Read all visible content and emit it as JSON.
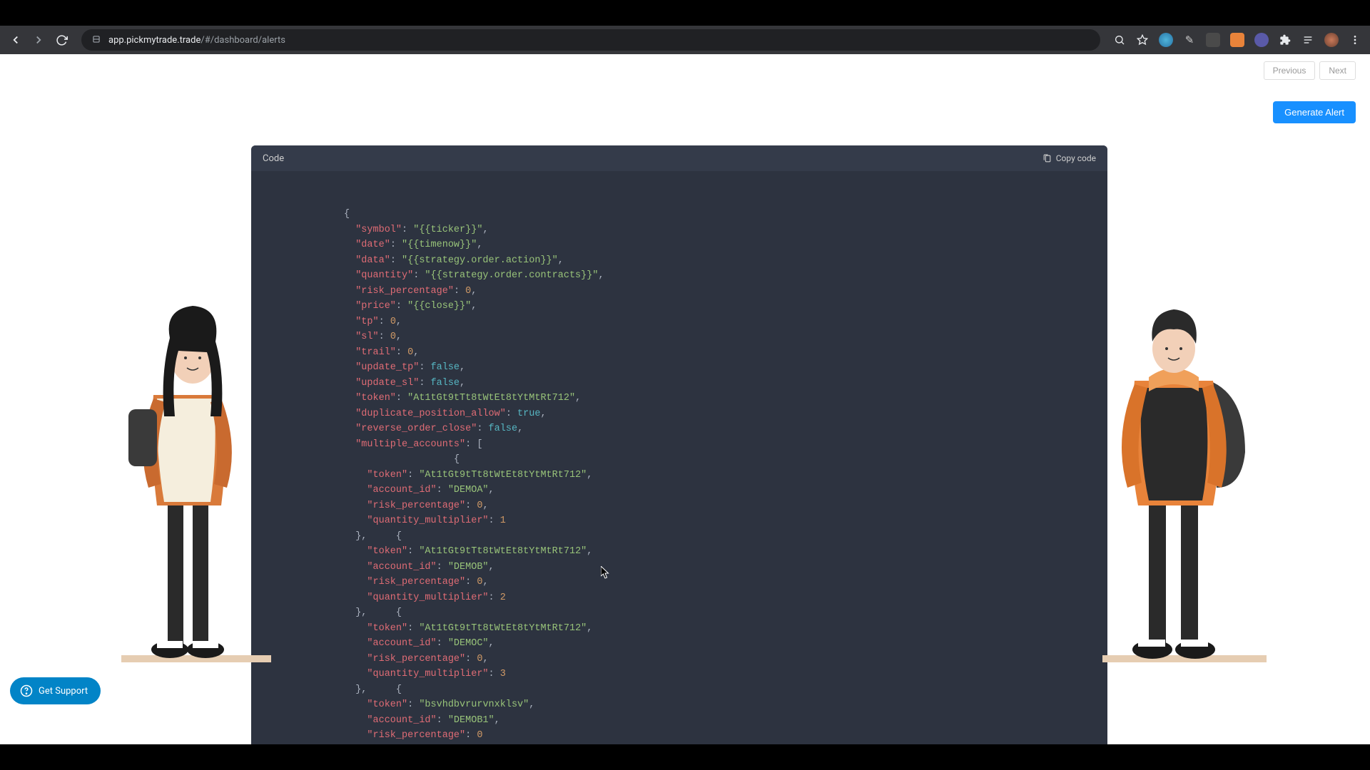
{
  "browser": {
    "url_host": "app.pickmytrade.trade",
    "url_path": "/#/dashboard/alerts"
  },
  "pagination": {
    "prev": "Previous",
    "next": "Next"
  },
  "actions": {
    "generate_alert": "Generate Alert"
  },
  "code_panel": {
    "title": "Code",
    "copy_label": "Copy code"
  },
  "support": {
    "label": "Get Support"
  },
  "code_json": {
    "symbol": "{{ticker}}",
    "date": "{{timenow}}",
    "data": "{{strategy.order.action}}",
    "quantity": "{{strategy.order.contracts}}",
    "risk_percentage": 0,
    "price": "{{close}}",
    "tp": 0,
    "sl": 0,
    "trail": 0,
    "update_tp": false,
    "update_sl": false,
    "token": "At1tGt9tTt8tWtEt8tYtMtRt712",
    "duplicate_position_allow": true,
    "reverse_order_close": false,
    "multiple_accounts": [
      {
        "token": "At1tGt9tTt8tWtEt8tYtMtRt712",
        "account_id": "DEMOA",
        "risk_percentage": 0,
        "quantity_multiplier": 1
      },
      {
        "token": "At1tGt9tTt8tWtEt8tYtMtRt712",
        "account_id": "DEMOB",
        "risk_percentage": 0,
        "quantity_multiplier": 2
      },
      {
        "token": "At1tGt9tTt8tWtEt8tYtMtRt712",
        "account_id": "DEMOC",
        "risk_percentage": 0,
        "quantity_multiplier": 3
      },
      {
        "token": "bsvhdbvrurvnxklsv",
        "account_id": "DEMOB1",
        "risk_percentage": 0
      }
    ]
  }
}
